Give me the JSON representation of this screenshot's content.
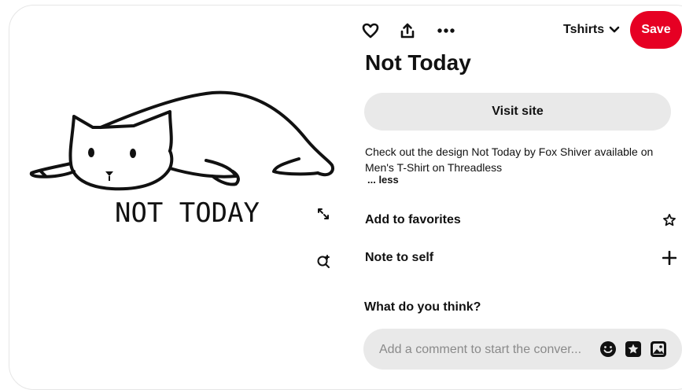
{
  "board": {
    "name": "Tshirts"
  },
  "actions": {
    "save_label": "Save"
  },
  "pin": {
    "image_text": "NOT TODAY",
    "title": "Not Today",
    "visit_label": "Visit site",
    "description": "Check out the design Not Today by Fox Shiver available on Men's T-Shirt on Threadless",
    "less_label": "... less"
  },
  "rows": {
    "favorites": "Add to favorites",
    "note": "Note to self"
  },
  "comments": {
    "heading": "What do you think?",
    "placeholder": "Add a comment to start the conver..."
  },
  "colors": {
    "save": "#e60023",
    "button_bg": "#e9e9e9",
    "text": "#111111"
  },
  "icons": [
    "heart-icon",
    "share-icon",
    "more-icon",
    "chevron-down-icon",
    "expand-icon",
    "visual-search-icon",
    "star-icon",
    "plus-icon",
    "emoji-icon",
    "sticker-icon",
    "image-icon"
  ]
}
